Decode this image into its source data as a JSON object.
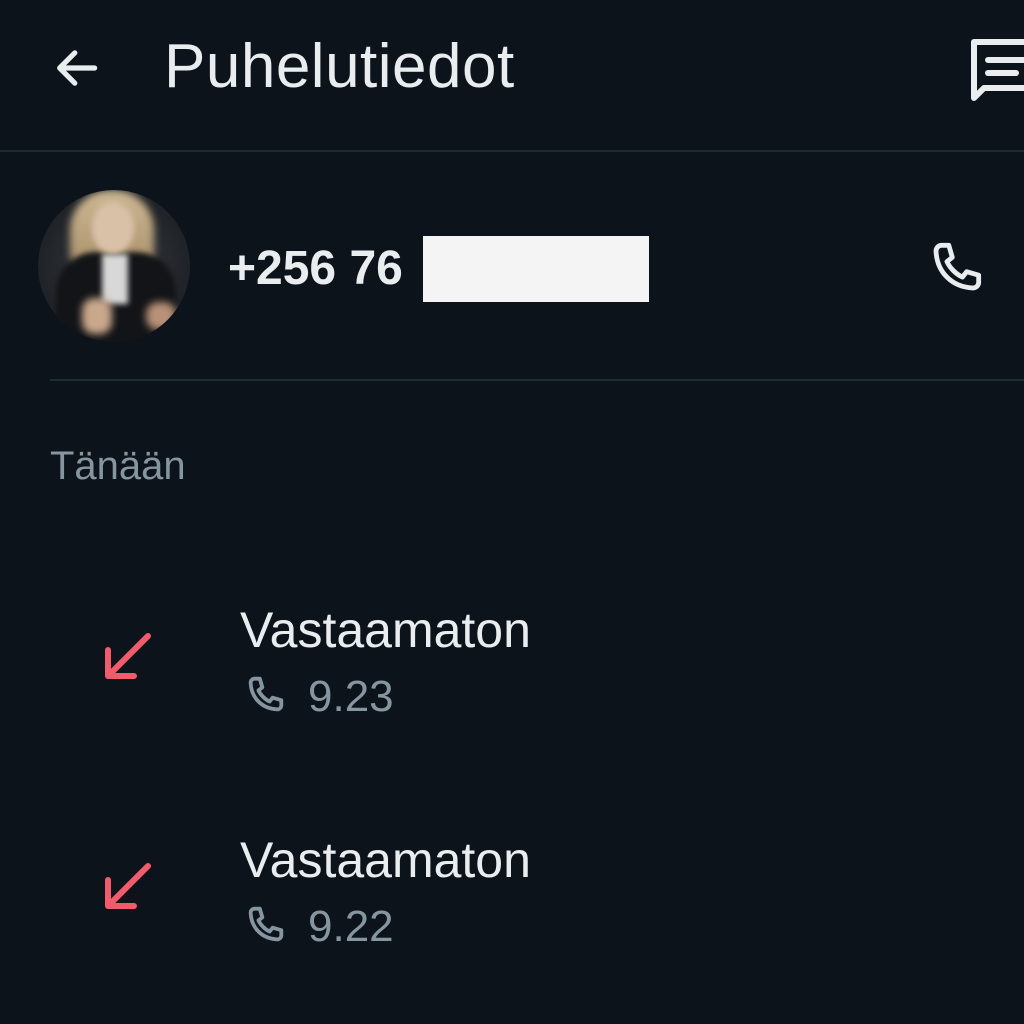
{
  "app_bar": {
    "title": "Puhelutiedot",
    "back_icon": "arrow-left-icon",
    "message_icon": "message-icon"
  },
  "contact": {
    "phone_number": "+256 76",
    "phone_number_redacted": true,
    "call_icon": "phone-icon"
  },
  "section": {
    "header": "Tänään"
  },
  "calls": [
    {
      "status": "Vastaamaton",
      "time": "9.23",
      "direction_icon": "missed-call-arrow-icon"
    },
    {
      "status": "Vastaamaton",
      "time": "9.22",
      "direction_icon": "missed-call-arrow-icon"
    }
  ],
  "colors": {
    "background": "#0c131b",
    "primary_text": "#e9edef",
    "secondary_text": "#8696a0",
    "missed_call": "#f15c6d",
    "divider": "#1e2d33"
  }
}
